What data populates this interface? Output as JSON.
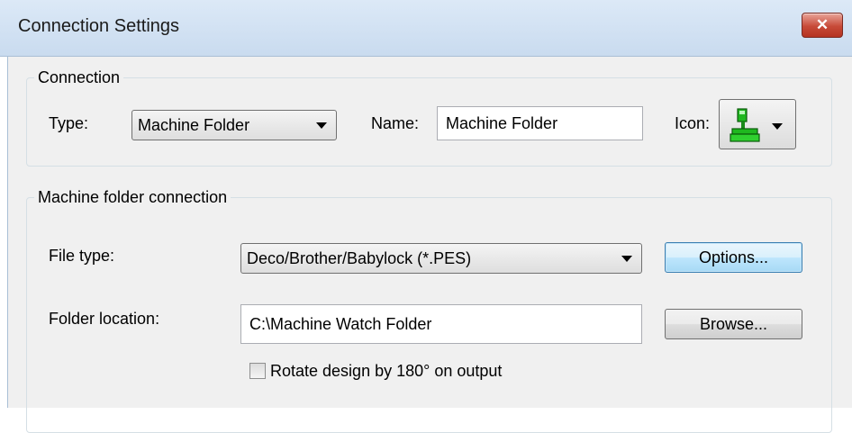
{
  "window": {
    "title": "Connection Settings",
    "close_label": "✕"
  },
  "connection": {
    "group_label": "Connection",
    "type_label": "Type:",
    "type_value": "Machine Folder",
    "name_label": "Name:",
    "name_value": "Machine Folder",
    "icon_label": "Icon:",
    "icon_name": "embroidery-machine-icon"
  },
  "machine_folder": {
    "group_label": "Machine folder connection",
    "file_type_label": "File type:",
    "file_type_value": "Deco/Brother/Babylock (*.PES)",
    "options_label": "Options...",
    "folder_label": "Folder location:",
    "folder_value": "C:\\Machine Watch Folder",
    "browse_label": "Browse...",
    "rotate_label": "Rotate design by 180° on output",
    "rotate_checked": false
  },
  "colors": {
    "title_bar": "#dce9f7",
    "dialog_bg": "#f0f0f0",
    "close_button": "#c74a38",
    "default_button": "#bee6fd",
    "icon_green": "#1fb81f"
  }
}
